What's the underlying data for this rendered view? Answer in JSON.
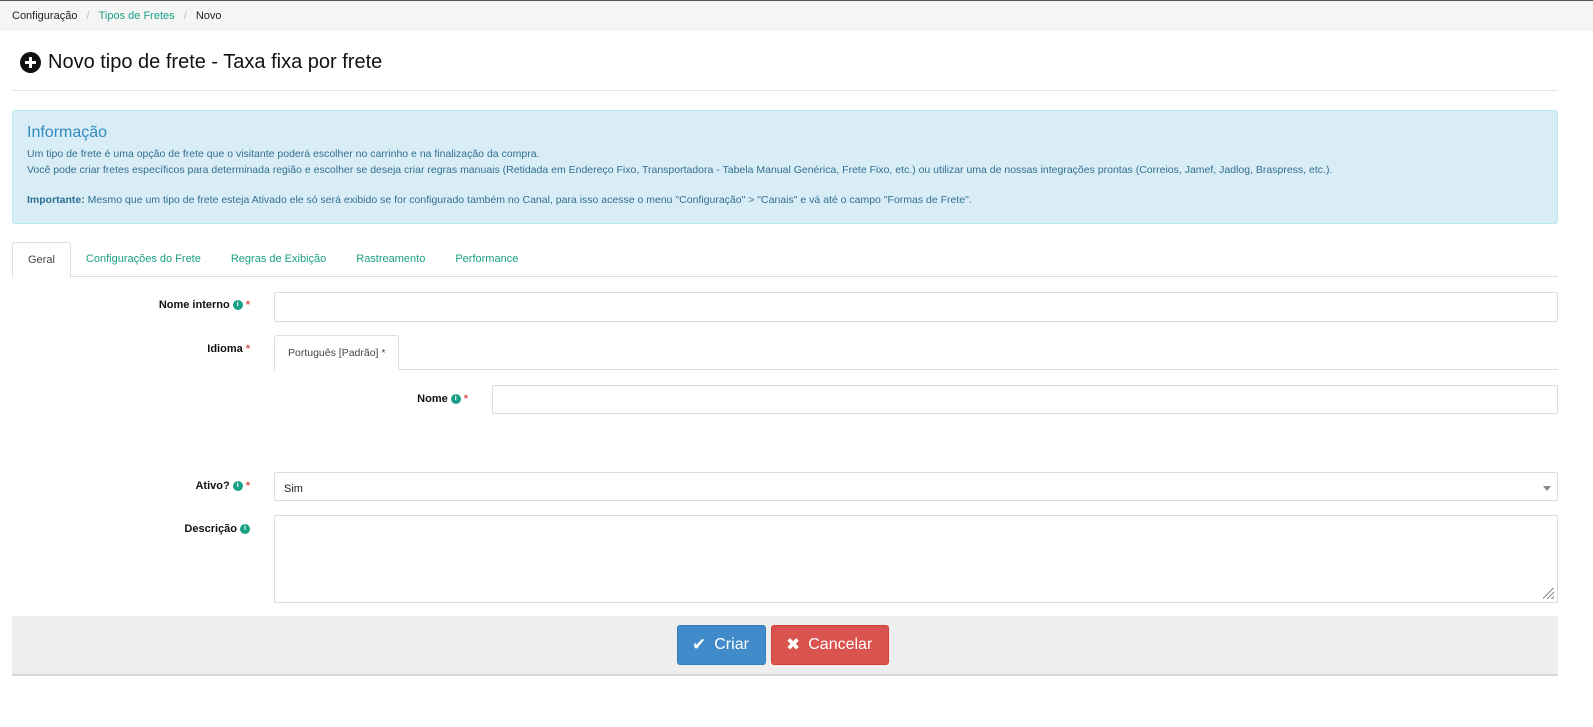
{
  "breadcrumb": {
    "root": "Configuração",
    "parent": "Tipos de Fretes",
    "current": "Novo"
  },
  "page": {
    "title": "Novo tipo de frete - Taxa fixa por frete",
    "icon": "plus-circle-icon"
  },
  "info": {
    "title": "Informação",
    "line1": "Um tipo de frete é uma opção de frete que o visitante poderá escolher no carrinho e na finalização da compra.",
    "line2": "Você pode criar fretes específicos para determinada região e escolher se deseja criar regras manuais (Retidada em Endereço Fixo, Transportadora - Tabela Manual Genérica, Frete Fixo, etc.) ou utilizar uma de nossas integrações prontas (Correios, Jamef, Jadlog, Braspress, etc.).",
    "important_label": "Importante:",
    "important_text": "Mesmo que um tipo de frete esteja Ativado ele só será exibido se for configurado também no Canal, para isso acesse o menu \"Configuração\" > \"Canais\" e vá até o campo \"Formas de Frete\"."
  },
  "tabs": [
    {
      "label": "Geral"
    },
    {
      "label": "Configurações do Frete"
    },
    {
      "label": "Regras de Exibição"
    },
    {
      "label": "Rastreamento"
    },
    {
      "label": "Performance"
    }
  ],
  "form": {
    "internal_name": {
      "label": "Nome interno",
      "value": ""
    },
    "language": {
      "label": "Idioma",
      "tab": "Português [Padrão] *"
    },
    "name": {
      "label": "Nome",
      "value": ""
    },
    "active": {
      "label": "Ativo?",
      "value": "Sim"
    },
    "description": {
      "label": "Descrição",
      "value": ""
    },
    "required_mark": "*",
    "info_glyph": "i"
  },
  "actions": {
    "create": "Criar",
    "cancel": "Cancelar",
    "create_icon": "check-icon",
    "cancel_icon": "close-icon"
  },
  "colors": {
    "accent": "#1aa085",
    "info_bg": "#d9edf7",
    "primary": "#428bca",
    "danger": "#d9534f"
  }
}
